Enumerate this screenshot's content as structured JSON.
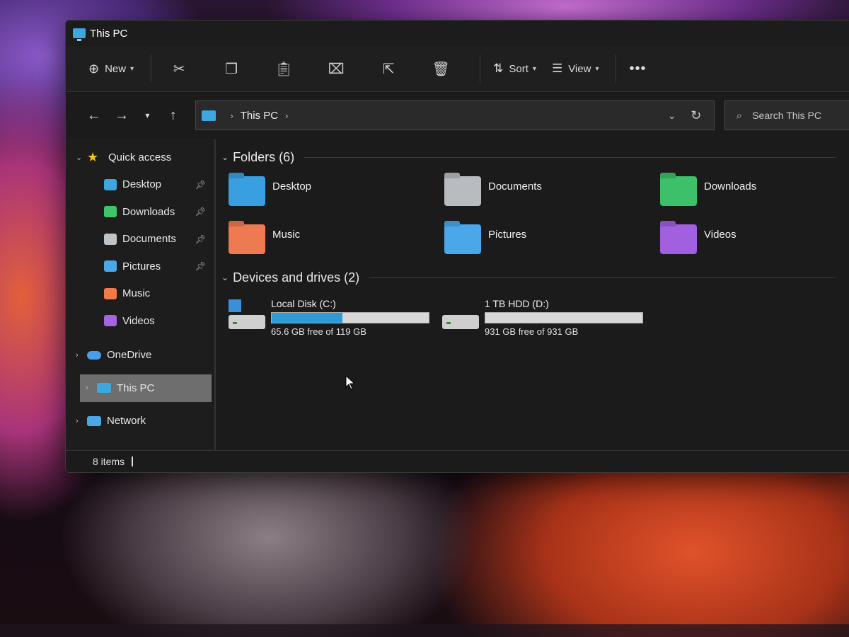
{
  "window": {
    "title": "This PC"
  },
  "toolbar": {
    "new_label": "New",
    "sort_label": "Sort",
    "view_label": "View",
    "icons": [
      "cut-icon",
      "copy-icon",
      "paste-icon",
      "rename-icon",
      "share-icon",
      "delete-icon"
    ]
  },
  "address": {
    "location": "This PC"
  },
  "search": {
    "placeholder": "Search This PC"
  },
  "sidebar": {
    "quick_access": "Quick access",
    "items": [
      {
        "label": "Desktop",
        "icon": "desktop-icon",
        "pinned": true,
        "color": "#3fa7e0"
      },
      {
        "label": "Downloads",
        "icon": "download-icon",
        "pinned": true,
        "color": "#3ec46a"
      },
      {
        "label": "Documents",
        "icon": "document-icon",
        "pinned": true,
        "color": "#bfc4c9"
      },
      {
        "label": "Pictures",
        "icon": "pictures-icon",
        "pinned": true,
        "color": "#4aa8e8"
      },
      {
        "label": "Music",
        "icon": "music-icon",
        "pinned": false,
        "color": "#f07a4a"
      },
      {
        "label": "Videos",
        "icon": "videos-icon",
        "pinned": false,
        "color": "#a564e0"
      }
    ],
    "onedrive": "OneDrive",
    "this_pc": "This PC",
    "network": "Network"
  },
  "folders": {
    "header": "Folders (6)",
    "items": [
      {
        "name": "Desktop",
        "color": "#3a9fe0"
      },
      {
        "name": "Documents",
        "color": "#b8bcc0"
      },
      {
        "name": "Downloads",
        "color": "#3cc06a"
      },
      {
        "name": "Music",
        "color": "#ee7a52"
      },
      {
        "name": "Pictures",
        "color": "#4aa8ea"
      },
      {
        "name": "Videos",
        "color": "#a060e0"
      }
    ]
  },
  "drives": {
    "header": "Devices and drives (2)",
    "items": [
      {
        "name": "Local Disk (C:)",
        "free_text": "65.6 GB free of 119 GB",
        "used_fraction": 0.45,
        "windows": true
      },
      {
        "name": "1 TB HDD (D:)",
        "free_text": "931 GB free of 931 GB",
        "used_fraction": 0.0,
        "windows": false
      }
    ]
  },
  "status": {
    "items": "8 items"
  }
}
